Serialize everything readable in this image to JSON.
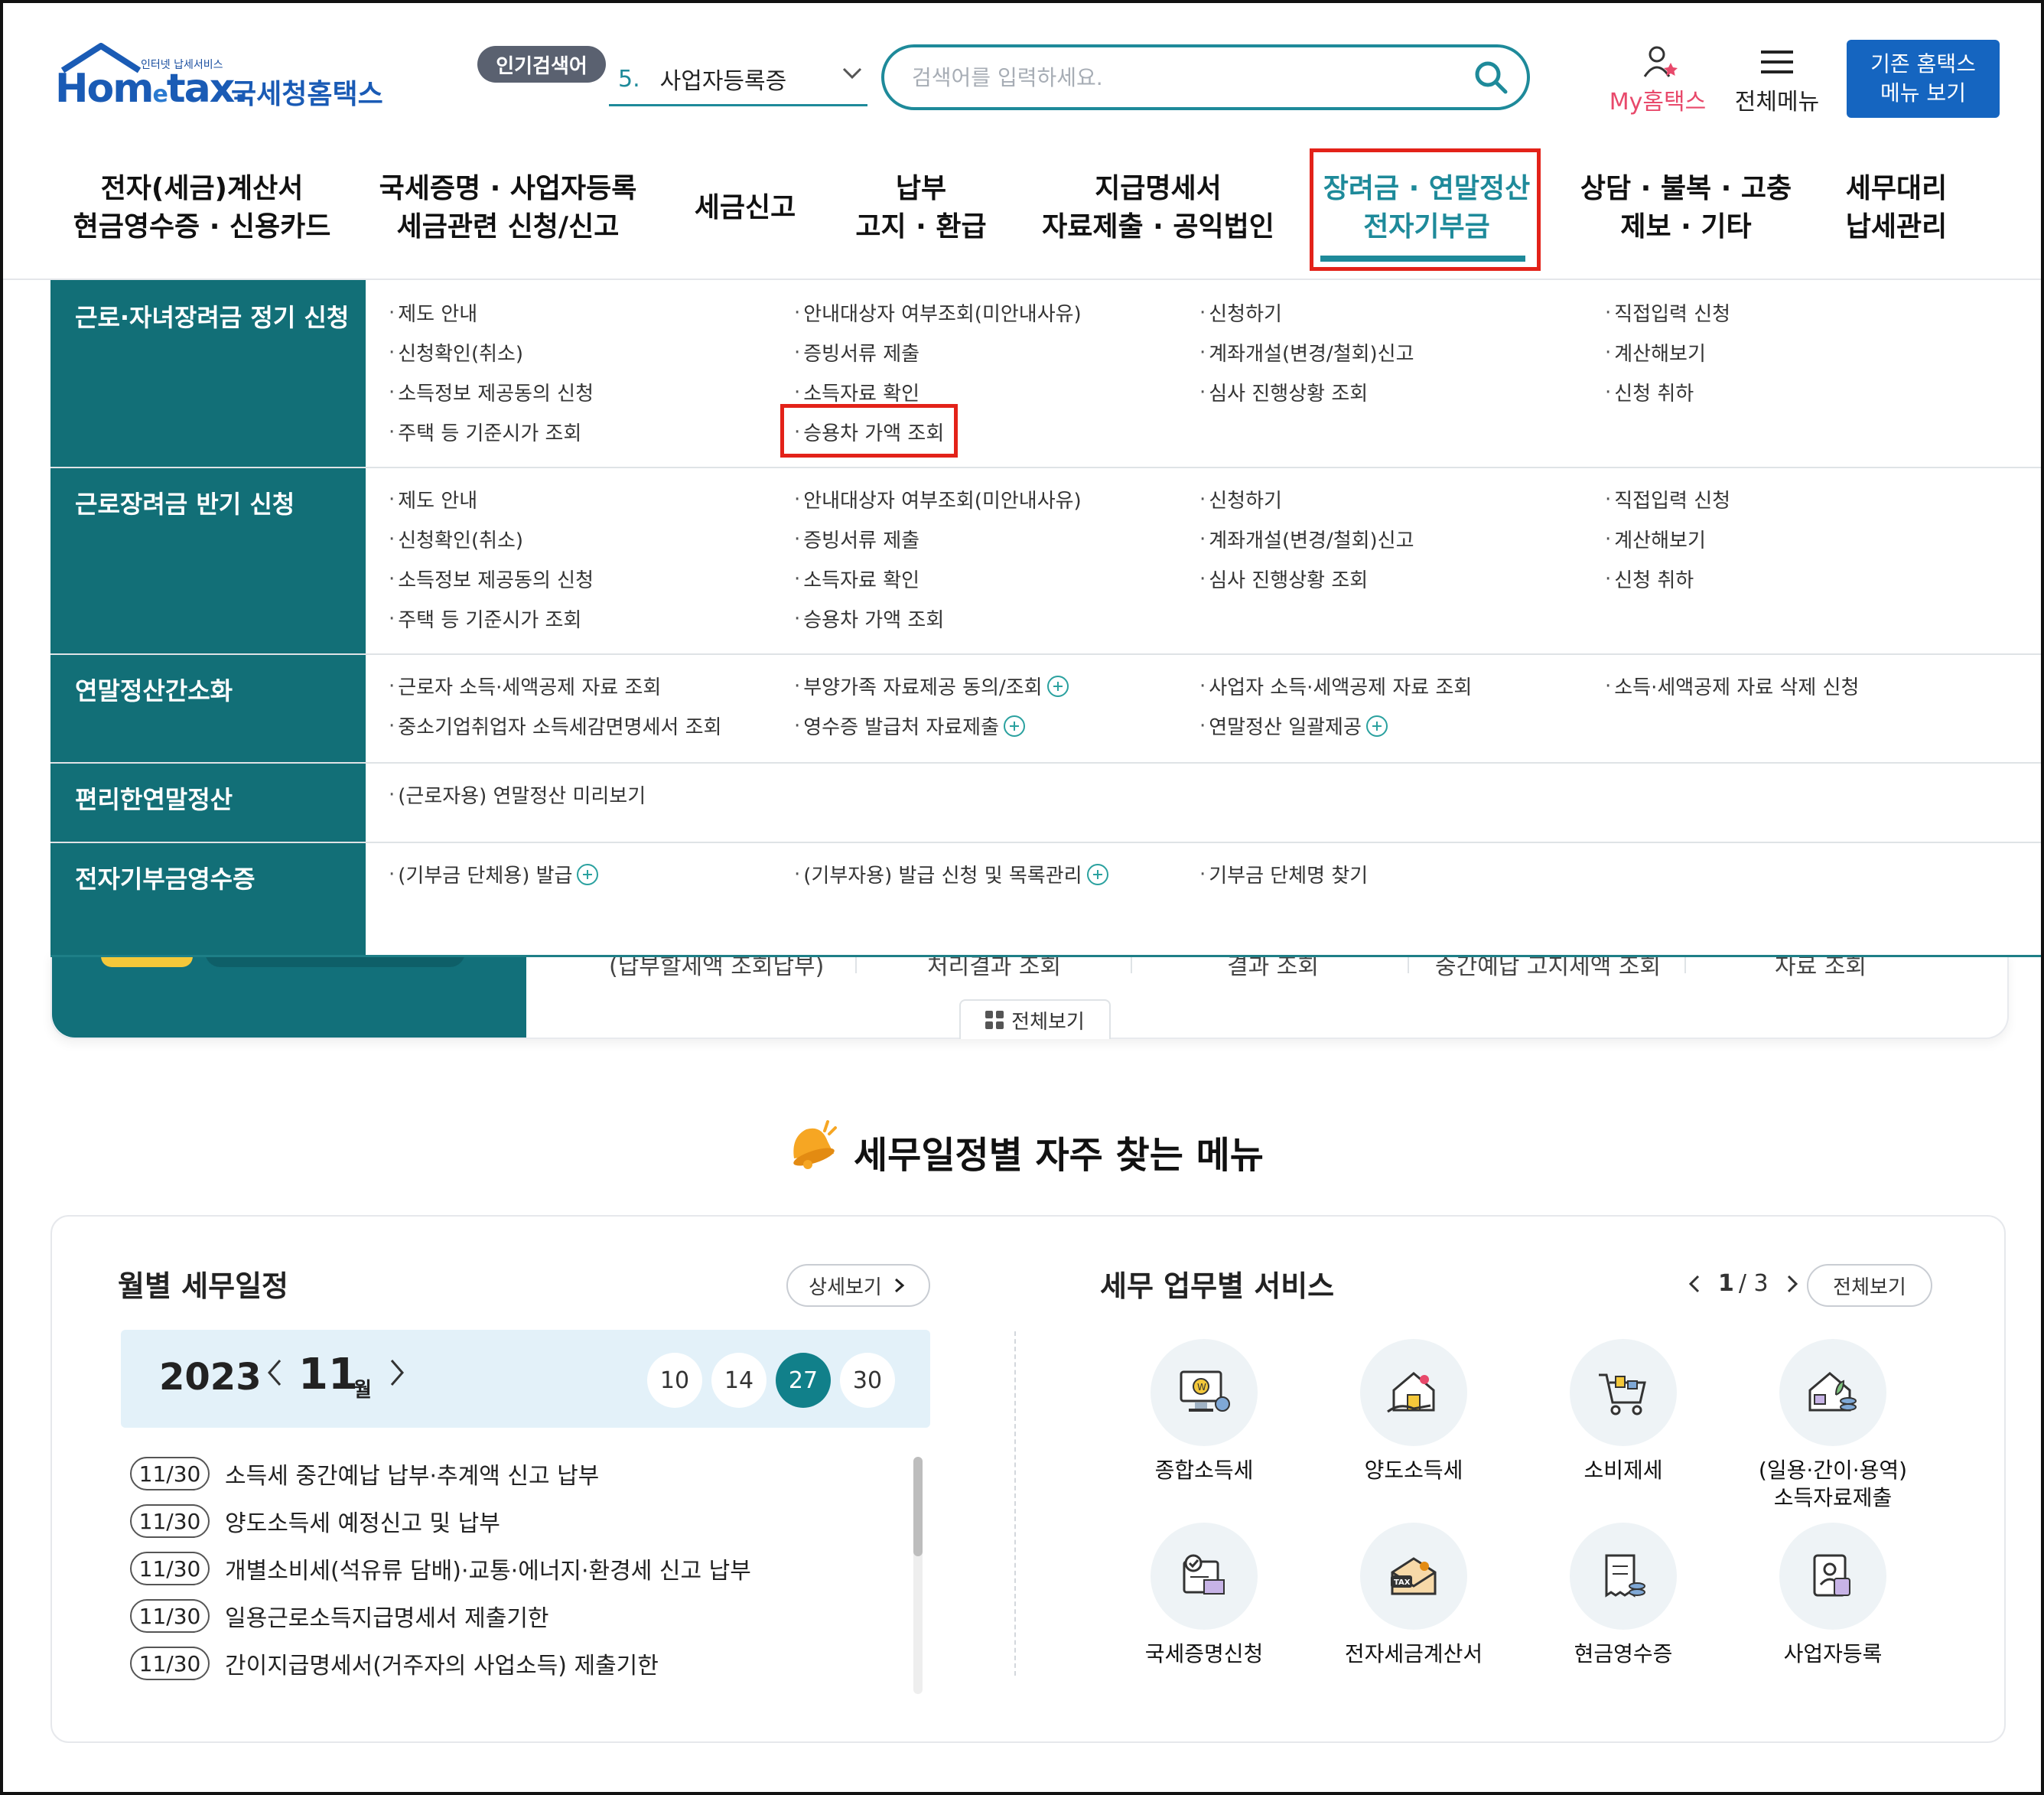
{
  "header": {
    "logo_tag": "인터넷 납세서비스",
    "logo_text_main": "Hom",
    "logo_text_e": "e",
    "logo_text_rest": "tax.",
    "logo_kr": "국세청홈택스",
    "popular_badge": "인기검색어",
    "popular_num": "5.",
    "popular_value": "사업자등록증",
    "search_placeholder": "검색어를 입력하세요.",
    "my_home": "My홈택스",
    "all_menu": "전체메뉴",
    "old_btn_line1": "기존 홈택스",
    "old_btn_line2": "메뉴 보기",
    "accent": "#1e8a9a"
  },
  "gnb": [
    {
      "l1": "전자(세금)계산서",
      "l2": "현금영수증 · 신용카드"
    },
    {
      "l1": "국세증명 · 사업자등록",
      "l2": "세금관련 신청/신고"
    },
    {
      "l1": "세금신고",
      "l2": ""
    },
    {
      "l1": "납부",
      "l2": "고지 · 환급"
    },
    {
      "l1": "지급명세서",
      "l2": "자료제출 · 공익법인"
    },
    {
      "l1": "장려금 · 연말정산",
      "l2": "전자기부금"
    },
    {
      "l1": "상담 · 불복 · 고충",
      "l2": "제보 · 기타"
    },
    {
      "l1": "세무대리",
      "l2": "납세관리"
    }
  ],
  "mega": {
    "rows": [
      {
        "title": "근로·자녀장려금 정기 신청",
        "links": [
          [
            "제도 안내",
            "신청확인(취소)",
            "소득정보 제공동의 신청",
            "주택 등 기준시가 조회"
          ],
          [
            "안내대상자 여부조회(미안내사유)",
            "증빙서류 제출",
            "소득자료 확인",
            "승용차 가액 조회"
          ],
          [
            "신청하기",
            "계좌개설(변경/철회)신고",
            "심사 진행상황 조회"
          ],
          [
            "직접입력 신청",
            "계산해보기",
            "신청 취하"
          ]
        ]
      },
      {
        "title": "근로장려금 반기 신청",
        "links": [
          [
            "제도 안내",
            "신청확인(취소)",
            "소득정보 제공동의 신청",
            "주택 등 기준시가 조회"
          ],
          [
            "안내대상자 여부조회(미안내사유)",
            "증빙서류 제출",
            "소득자료 확인",
            "승용차 가액 조회"
          ],
          [
            "신청하기",
            "계좌개설(변경/철회)신고",
            "심사 진행상황 조회"
          ],
          [
            "직접입력 신청",
            "계산해보기",
            "신청 취하"
          ]
        ]
      },
      {
        "title": "연말정산간소화",
        "links": [
          [
            "근로자 소득·세액공제 자료 조회",
            "중소기업취업자 소득세감면명세서 조회"
          ],
          [
            "부양가족 자료제공 동의/조회",
            "영수증 발급처 자료제출"
          ],
          [
            "사업자 소득·세액공제 자료 조회",
            "연말정산 일괄제공"
          ],
          [
            "소득·세액공제 자료 삭제 신청"
          ]
        ]
      },
      {
        "title": "편리한연말정산",
        "links": [
          [
            "(근로자용) 연말정산 미리보기"
          ]
        ]
      },
      {
        "title": "전자기부금영수증",
        "links": [
          [
            "(기부금 단체용) 발급"
          ],
          [
            "(기부자용) 발급 신청 및 목록관리"
          ],
          [
            "기부금 단체명 찾기"
          ]
        ]
      }
    ]
  },
  "banner_peek": [
    "(납부할세액 조회납부)",
    "처리결과 조회",
    "결과 조회",
    "중간예납 고지세액 조회",
    "자료 조회"
  ],
  "banner_view_all": "전체보기",
  "section_title": "세무일정별 자주 찾는 메뉴",
  "calendar": {
    "title": "월별 세무일정",
    "detail_btn": "상세보기",
    "year": "2023",
    "month": "11",
    "month_unit": "월",
    "days": [
      "10",
      "14",
      "27",
      "30"
    ],
    "active_day": "27",
    "schedule": [
      {
        "date": "11/30",
        "text": "소득세 중간예납 납부·추계액 신고 납부"
      },
      {
        "date": "11/30",
        "text": "양도소득세 예정신고 및 납부"
      },
      {
        "date": "11/30",
        "text": "개별소비세(석유류 담배)·교통·에너지·환경세 신고 납부"
      },
      {
        "date": "11/30",
        "text": "일용근로소득지급명세서 제출기한"
      },
      {
        "date": "11/30",
        "text": "간이지급명세서(거주자의 사업소득) 제출기한"
      }
    ]
  },
  "services": {
    "title": "세무 업무별 서비스",
    "page_cur": "1",
    "page_total": "/ 3",
    "view_all": "전체보기",
    "items": [
      {
        "label": "종합소득세",
        "icon": "monitor-coin-icon"
      },
      {
        "label": "양도소득세",
        "icon": "house-hand-icon"
      },
      {
        "label": "소비제세",
        "icon": "cart-icon"
      },
      {
        "label": "(일용·간이·용역)\n소득자료제출",
        "icon": "house-plant-coin-icon"
      },
      {
        "label": "국세증명신청",
        "icon": "certificate-check-icon"
      },
      {
        "label": "전자세금계산서",
        "icon": "tax-envelope-icon"
      },
      {
        "label": "현금영수증",
        "icon": "receipt-coin-icon"
      },
      {
        "label": "사업자등록",
        "icon": "id-card-person-icon"
      }
    ]
  }
}
